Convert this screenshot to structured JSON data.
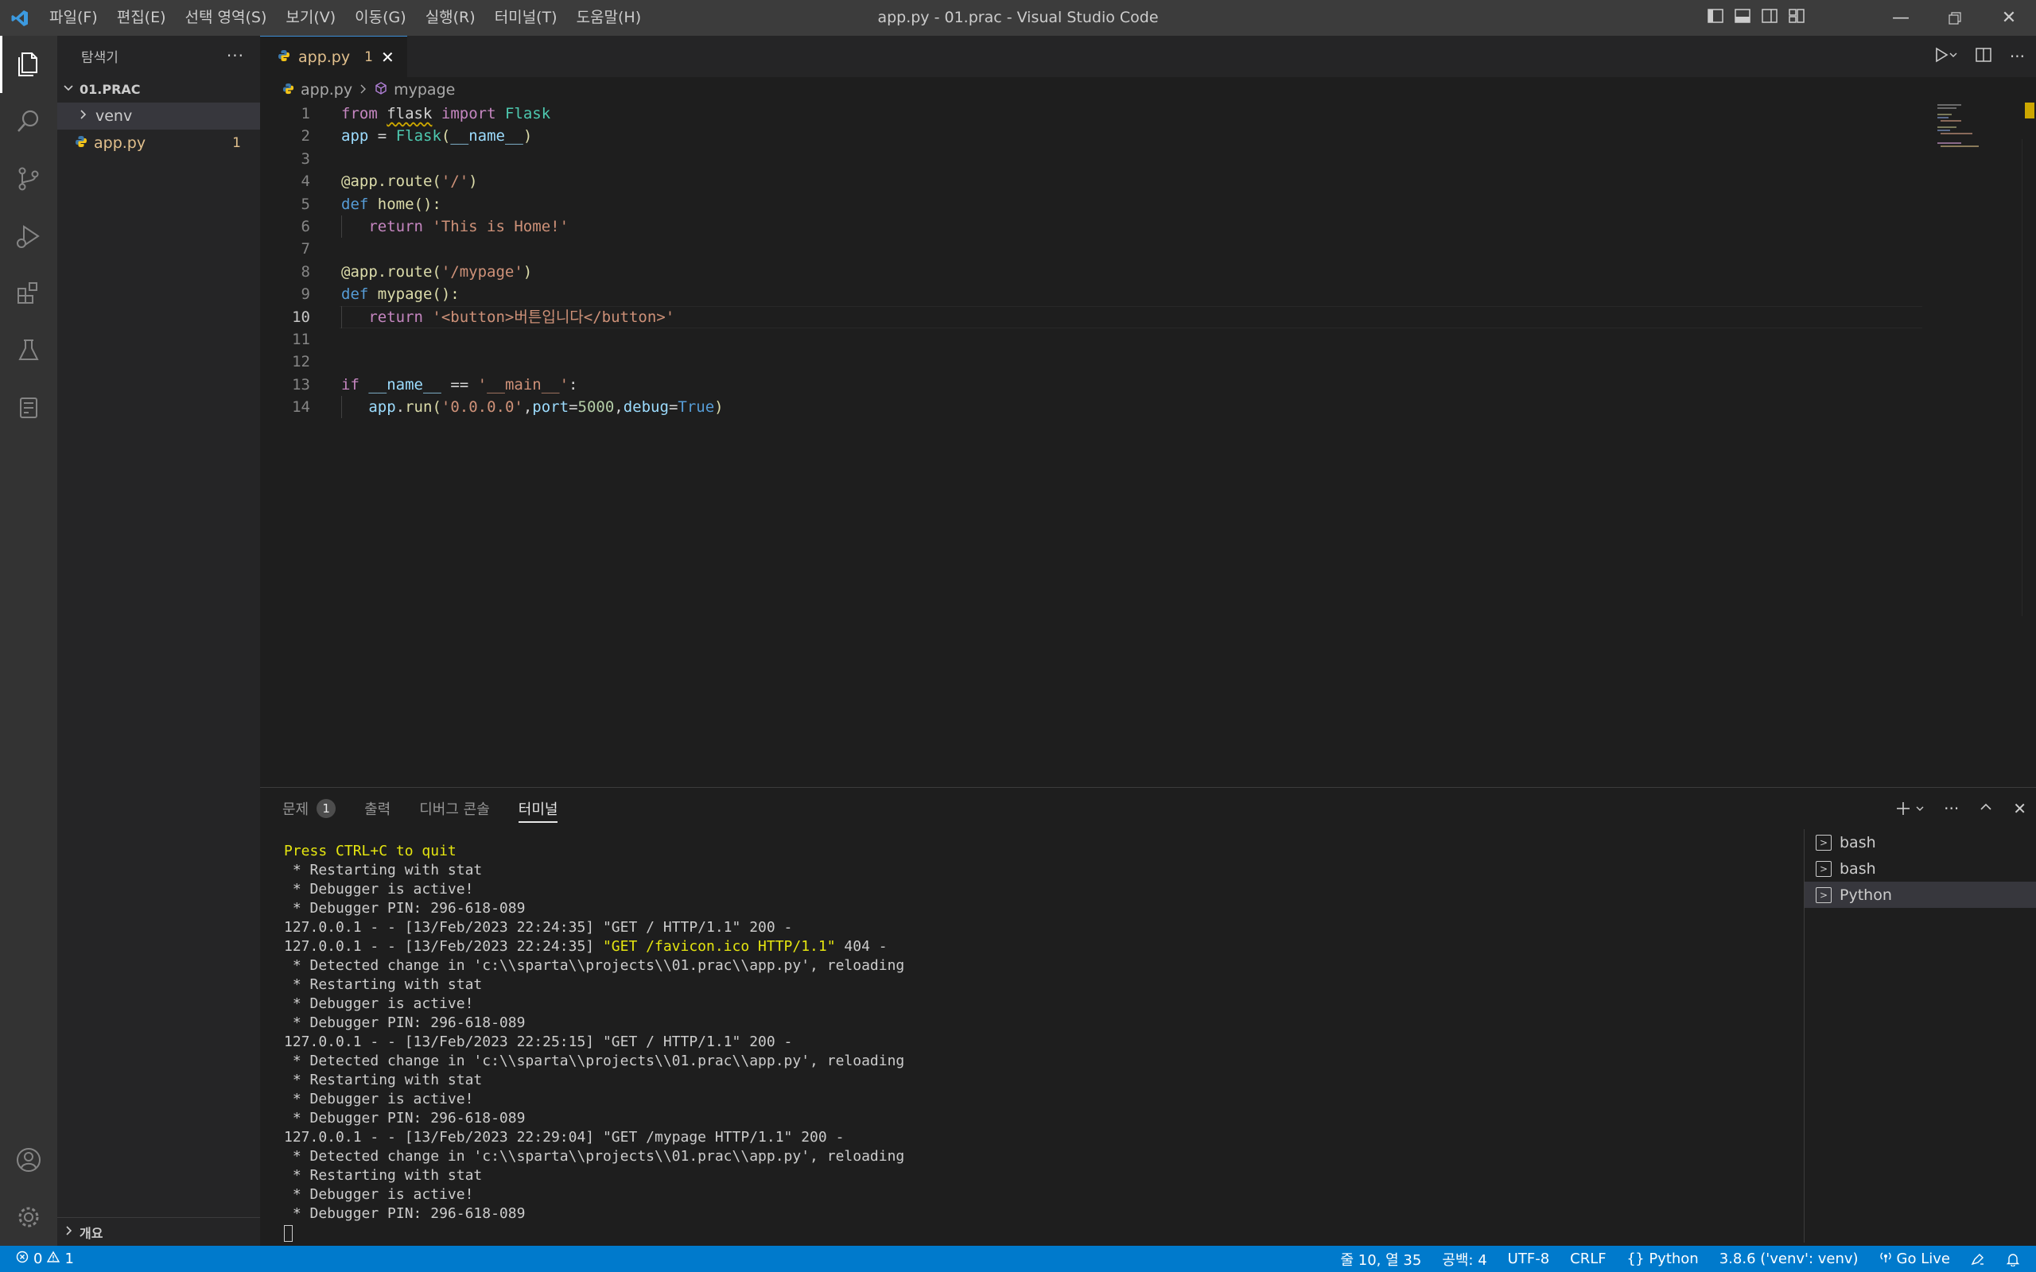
{
  "window": {
    "title": "app.py - 01.prac - Visual Studio Code",
    "accent": "#007acc"
  },
  "menu": [
    "파일(F)",
    "편집(E)",
    "선택 영역(S)",
    "보기(V)",
    "이동(G)",
    "실행(R)",
    "터미널(T)",
    "도움말(H)"
  ],
  "activitybar": [
    "files-icon",
    "search-icon",
    "source-control-icon",
    "run-debug-icon",
    "extensions-icon",
    "testing-icon",
    "remote-explorer-icon",
    "account-icon",
    "gear-icon"
  ],
  "sidebar": {
    "title": "탐색기",
    "folder": "01.PRAC",
    "items": [
      {
        "label": "venv"
      },
      {
        "label": "app.py",
        "badge": "1"
      }
    ],
    "outline_label": "개요"
  },
  "editor": {
    "tab": {
      "label": "app.py",
      "badge": "1"
    },
    "breadcrumb": {
      "file": "app.py",
      "symbol": "mypage"
    },
    "line_numbers": [
      "1",
      "2",
      "3",
      "4",
      "5",
      "6",
      "7",
      "8",
      "9",
      "10",
      "11",
      "12",
      "13",
      "14"
    ]
  },
  "panel": {
    "tabs": [
      {
        "label": "문제",
        "count": "1"
      },
      {
        "label": "출력"
      },
      {
        "label": "디버그 콘솔"
      },
      {
        "label": "터미널"
      }
    ],
    "terminal_lines": [
      "Press CTRL+C to quit",
      " * Restarting with stat",
      " * Debugger is active!",
      " * Debugger PIN: 296-618-089",
      "127.0.0.1 - - [13/Feb/2023 22:24:35] \"GET / HTTP/1.1\" 200 -",
      "127.0.0.1 - - [13/Feb/2023 22:24:35] ",
      " * Detected change in 'c:\\\\sparta\\\\projects\\\\01.prac\\\\app.py', reloading",
      " * Restarting with stat",
      " * Debugger is active!",
      " * Debugger PIN: 296-618-089",
      "127.0.0.1 - - [13/Feb/2023 22:25:15] \"GET / HTTP/1.1\" 200 -",
      " * Detected change in 'c:\\\\sparta\\\\projects\\\\01.prac\\\\app.py', reloading",
      " * Restarting with stat",
      " * Debugger is active!",
      " * Debugger PIN: 296-618-089",
      "127.0.0.1 - - [13/Feb/2023 22:29:04] \"GET /mypage HTTP/1.1\" 200 -",
      " * Detected change in 'c:\\\\sparta\\\\projects\\\\01.prac\\\\app.py', reloading",
      " * Restarting with stat",
      " * Debugger is active!",
      " * Debugger PIN: 296-618-089"
    ],
    "favicon_request": "\"GET /favicon.ico HTTP/1.1\"",
    "favicon_status": " 404 -",
    "terminals": [
      {
        "label": "bash"
      },
      {
        "label": "bash"
      },
      {
        "label": "Python"
      }
    ]
  },
  "statusbar": {
    "errors": "0",
    "warnings": "1",
    "position": "줄 10, 열 35",
    "spaces": "공백: 4",
    "encoding": "UTF-8",
    "eol": "CRLF",
    "language": "Python",
    "interpreter": "3.8.6 ('venv': venv)",
    "golive": "Go Live"
  }
}
